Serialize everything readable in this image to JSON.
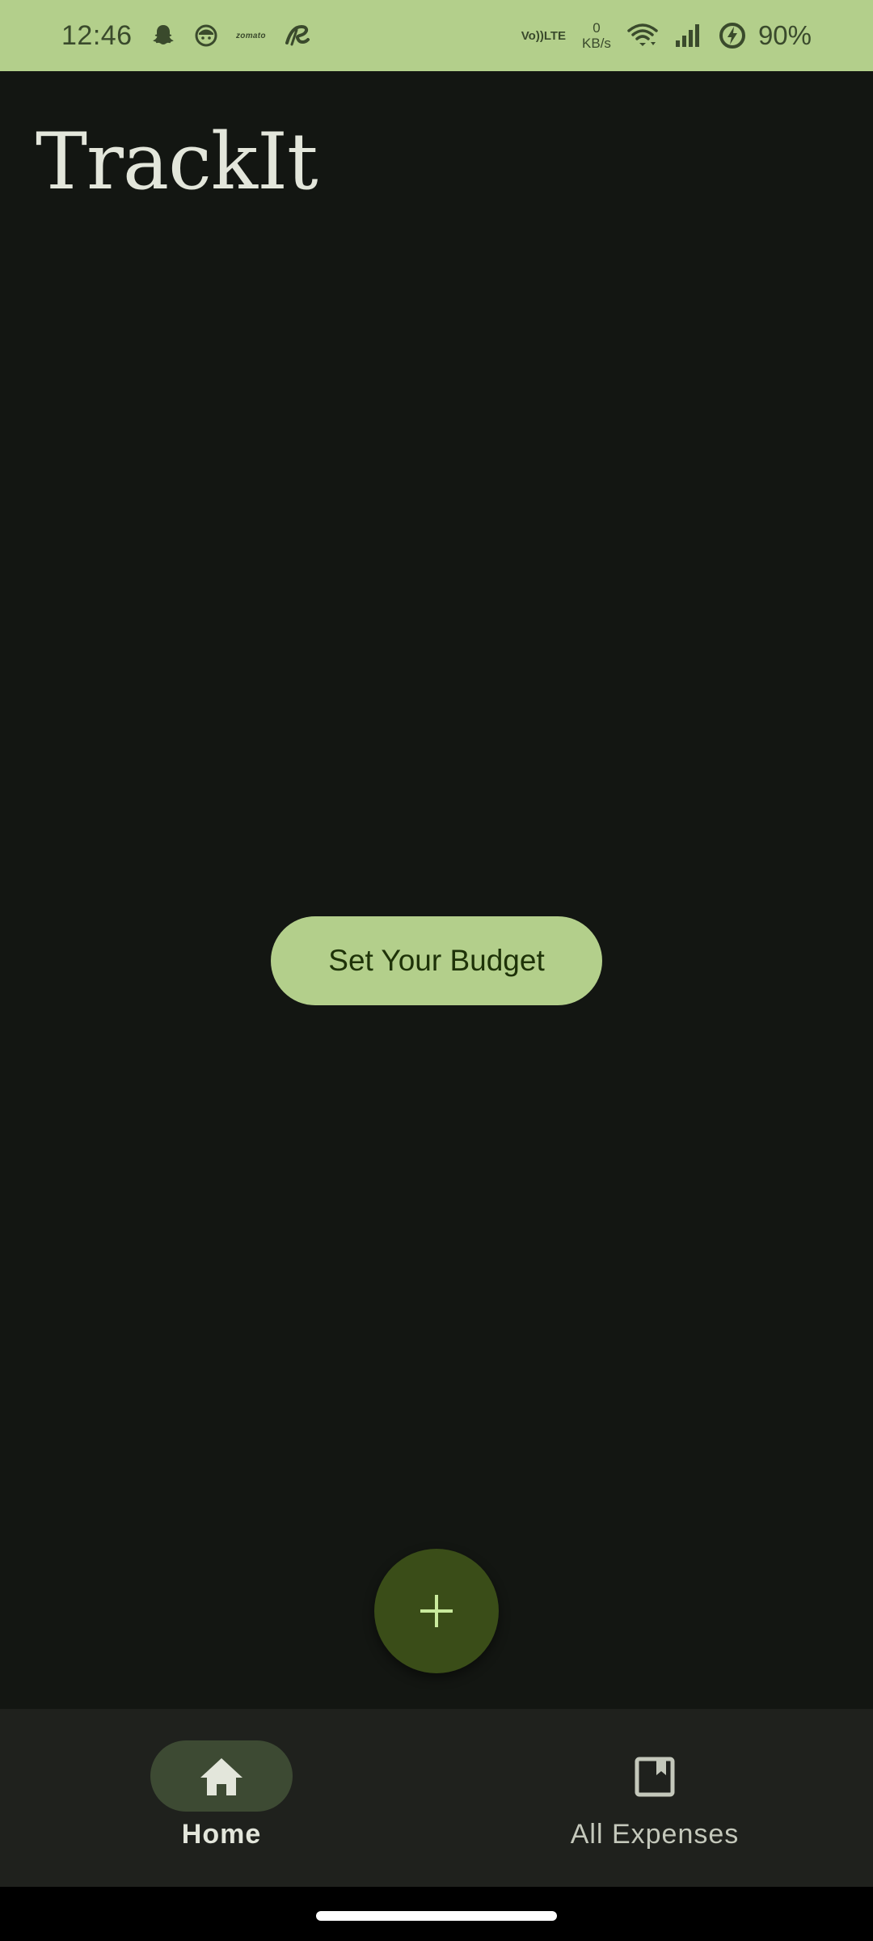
{
  "status_bar": {
    "time": "12:46",
    "notification_icons": [
      "snapchat-icon",
      "app-face-icon",
      "zomato-icon",
      "app-swirl-icon"
    ],
    "zomato_text": "zomato",
    "volte_line1": "Vo))",
    "volte_line2": "LTE",
    "net_speed_value": "0",
    "net_speed_unit": "KB/s",
    "battery_percent": "90%",
    "background_color": "#b3cf8b"
  },
  "app": {
    "title": "TrackIt",
    "background_color": "#131612"
  },
  "main": {
    "set_budget_label": "Set Your Budget",
    "button_color": "#b3cf8b"
  },
  "fab": {
    "icon": "plus-icon",
    "color": "#3a4d18",
    "icon_color": "#c9ea9d"
  },
  "bottom_nav": {
    "items": [
      {
        "label": "Home",
        "icon": "home-icon",
        "selected": true
      },
      {
        "label": "All Expenses",
        "icon": "bookmark-icon",
        "selected": false
      }
    ],
    "background_color": "#1f211d",
    "indicator_color": "#3d4a33"
  }
}
